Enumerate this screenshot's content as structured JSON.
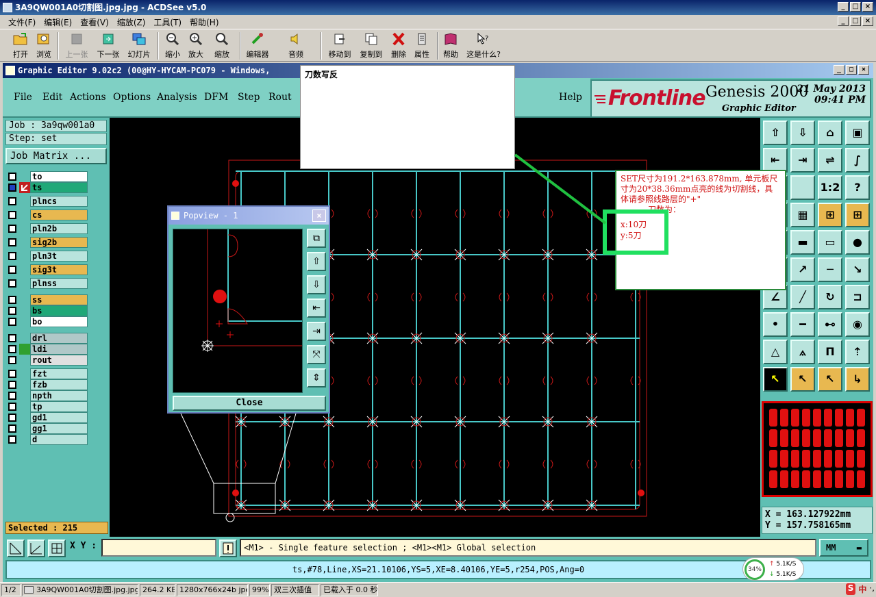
{
  "acdsee": {
    "title": "3A9QW001A0切割图.jpg.jpg - ACDSee v5.0",
    "menu": [
      "文件(F)",
      "编辑(E)",
      "查看(V)",
      "缩放(Z)",
      "工具(T)",
      "帮助(H)"
    ],
    "toolbar": [
      "打开",
      "浏览",
      "上一张",
      "下一张",
      "幻灯片",
      "缩小",
      "放大",
      "缩放",
      "编辑器",
      "音频",
      "移动到",
      "复制到",
      "删除",
      "属性",
      "帮助",
      "这是什么?"
    ]
  },
  "genesis": {
    "title": "Graphic Editor 9.02c2 (00@HY-HYCAM-PC079 - Windows,",
    "menu": [
      "File",
      "Edit",
      "Actions",
      "Options",
      "Analysis",
      "DFM",
      "Step",
      "Rout",
      "Help"
    ],
    "logo": {
      "brand": "Frontline",
      "product": "Genesis 2000",
      "subtitle": "Graphic Editor",
      "date": "21 May 2013",
      "time": "09:41 PM"
    },
    "job": "Job : 3a9qw001a0",
    "step": "Step: set",
    "job_matrix": "Job Matrix ...",
    "layers": [
      {
        "name": "to",
        "color": "#ffffff"
      },
      {
        "name": "ts",
        "color": "#20a878"
      },
      {
        "name": "plncs",
        "color": "#b9e4dd"
      },
      {
        "name": "cs",
        "color": "#e8b850"
      },
      {
        "name": "pln2b",
        "color": "#b9e4dd"
      },
      {
        "name": "sig2b",
        "color": "#e8b850"
      },
      {
        "name": "pln3t",
        "color": "#b9e4dd"
      },
      {
        "name": "sig3t",
        "color": "#e8b850"
      },
      {
        "name": "plnss",
        "color": "#b9e4dd"
      },
      {
        "name": "ss",
        "color": "#e8b850"
      },
      {
        "name": "bs",
        "color": "#20a878"
      },
      {
        "name": "bo",
        "color": "#ffffff"
      },
      {
        "name": "drl",
        "color": "#b0c8c8"
      },
      {
        "name": "ldi",
        "color": "#b0c8c8"
      },
      {
        "name": "rout",
        "color": "#e0e0e0"
      },
      {
        "name": "fzt",
        "color": "#b9e4dd"
      },
      {
        "name": "fzb",
        "color": "#b9e4dd"
      },
      {
        "name": "npth",
        "color": "#b9e4dd"
      },
      {
        "name": "tp",
        "color": "#b9e4dd"
      },
      {
        "name": "gd1",
        "color": "#b9e4dd"
      },
      {
        "name": "gg1",
        "color": "#b9e4dd"
      },
      {
        "name": "d",
        "color": "#b9e4dd"
      }
    ],
    "selected": "Selected : 215",
    "coords": {
      "x": "X  =  163.127922mm",
      "y": "Y  =  157.758165mm"
    },
    "xy_label": "X Y :",
    "xy_value": "",
    "message": "<M1> - Single feature selection ; <M1><M1> Global selection",
    "units": "MM",
    "feature_info": "ts,#78,Line,XS=21.10106,YS=5,XE=8.40106,YE=5,r254,POS,Ang=0"
  },
  "popview": {
    "title": "Popview - 1",
    "close": "Close"
  },
  "notes": {
    "note1": "刀数写反",
    "note2_line1": "SET尺寸为191.2*163.878mm, 单元板尺寸为20*38.36mm点亮的线为切割线，具体请参照线路层的\"+\"",
    "note2_line2": "刀数为：",
    "note2_x": "x:10刀",
    "note2_y": "y:5刀"
  },
  "statusbar": {
    "page": "1/2",
    "file": "3A9QW001A0切割图.jpg.jpg",
    "size": "264.2 KB",
    "dims": "1280x766x24b jpeg",
    "zoom": "99%",
    "interp": "双三次插值",
    "loaded": "已载入于 0.0 秒"
  },
  "netgauge": {
    "pct": "34%",
    "up": "5.1K/S",
    "down": "5.1K/S"
  },
  "tray": [
    "S",
    "中",
    "·,"
  ]
}
